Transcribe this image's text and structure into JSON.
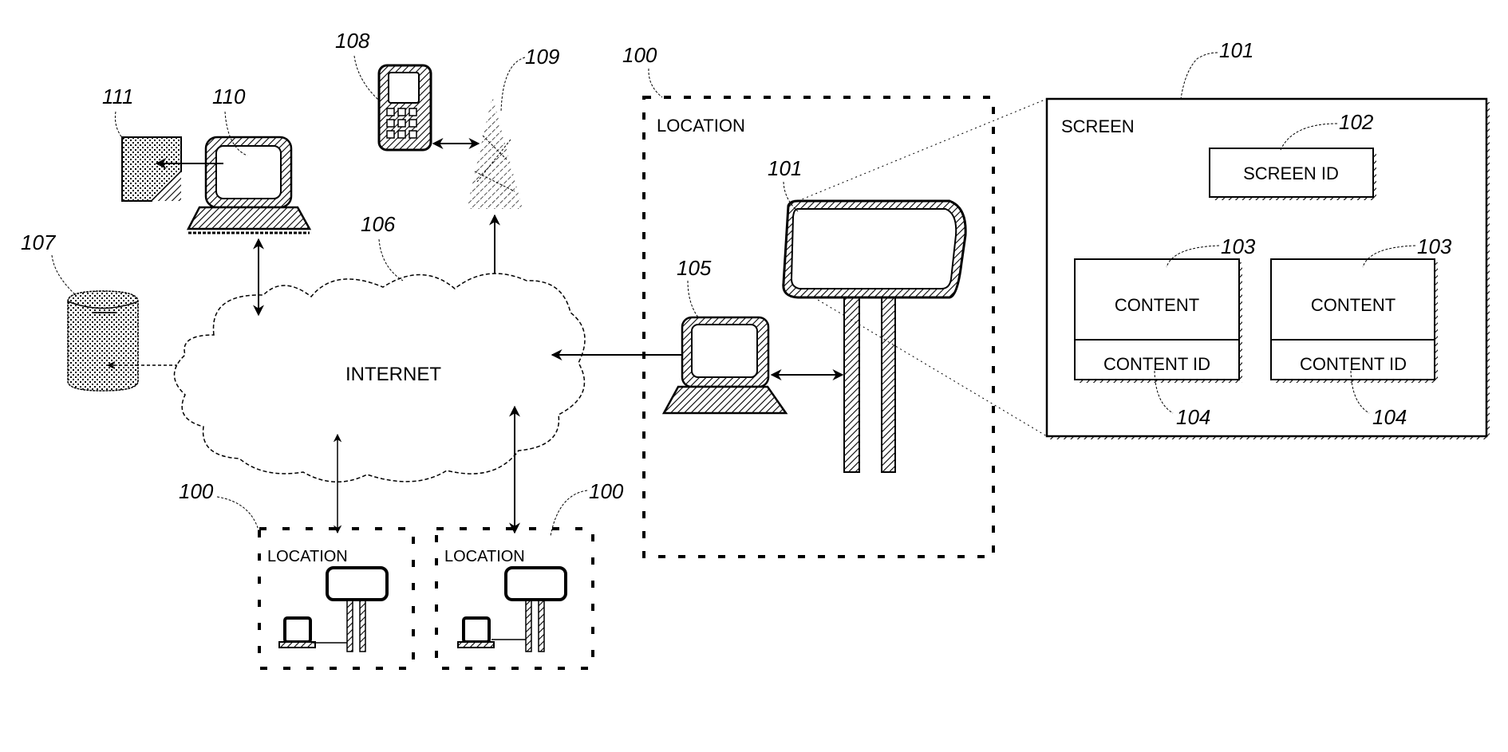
{
  "figure": {
    "type": "patent-style system diagram",
    "colors": {
      "ink": "#000000",
      "background": "#ffffff"
    }
  },
  "network": {
    "label": "INTERNET",
    "ref": "106"
  },
  "database": {
    "ref": "107"
  },
  "remote_computer": {
    "ref": "110"
  },
  "document": {
    "ref": "111"
  },
  "mobile_phone": {
    "ref": "108"
  },
  "cell_tower": {
    "ref": "109"
  },
  "main_location": {
    "ref": "100",
    "label": "LOCATION",
    "display": {
      "ref": "101"
    },
    "local_computer": {
      "ref": "105"
    }
  },
  "small_locations": [
    {
      "ref": "100",
      "label": "LOCATION"
    },
    {
      "ref": "100",
      "label": "LOCATION"
    }
  ],
  "screen_detail": {
    "ref": "101",
    "title": "SCREEN",
    "screen_id": {
      "ref": "102",
      "label": "SCREEN ID"
    },
    "contents": [
      {
        "ref": "103",
        "label": "CONTENT",
        "id_ref": "104",
        "id_label": "CONTENT ID"
      },
      {
        "ref": "103",
        "label": "CONTENT",
        "id_ref": "104",
        "id_label": "CONTENT ID"
      }
    ]
  }
}
